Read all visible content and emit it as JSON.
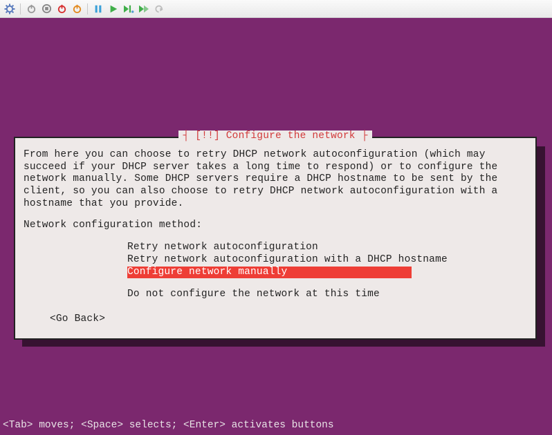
{
  "toolbar": {
    "icons": [
      "settings-gear",
      "power-grey",
      "stop-grey",
      "power-red",
      "power-orange",
      "separator",
      "pause",
      "play",
      "step-over",
      "step-into",
      "undo"
    ]
  },
  "dialog": {
    "title_prefix": "[!!] ",
    "title": "Configure the network",
    "body": "From here you can choose to retry DHCP network autoconfiguration (which may succeed if your DHCP server takes a long time to respond) or to configure the network manually. Some DHCP servers require a DHCP hostname to be sent by the client, so you can also choose to retry DHCP network autoconfiguration with a hostname that you provide.",
    "prompt": "Network configuration method:",
    "options": [
      "Retry network autoconfiguration",
      "Retry network autoconfiguration with a DHCP hostname",
      "Configure network manually",
      "Do not configure the network at this time"
    ],
    "selected_index": 2,
    "go_back": "<Go Back>"
  },
  "footer": "<Tab> moves; <Space> selects; <Enter> activates buttons"
}
